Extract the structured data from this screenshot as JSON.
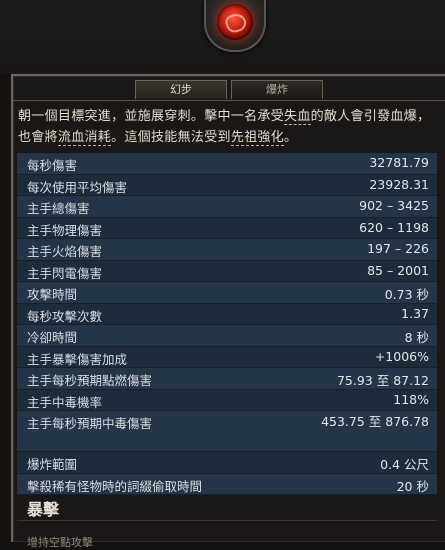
{
  "tabs": [
    "幻步",
    "爆炸"
  ],
  "description": {
    "pre_1": "朝一個目標突進，並施展穿刺。擊中一名承受",
    "kw_bleed": "失血",
    "pre_2": "的敵人會引發血爆，也會將",
    "kw_drain": "流血消耗",
    "pre_3": "。這個技能無法受到",
    "kw_ancestral": "先祖強化",
    "post": "。"
  },
  "stats": [
    {
      "label": "每秒傷害",
      "value": "32781.79"
    },
    {
      "label": "每次使用平均傷害",
      "value": "23928.31"
    },
    {
      "label": "主手總傷害",
      "value": "902 – 3425"
    },
    {
      "label": "主手物理傷害",
      "value": "620 – 1198"
    },
    {
      "label": "主手火焰傷害",
      "value": "197 – 226"
    },
    {
      "label": "主手閃電傷害",
      "value": "85 – 2001"
    },
    {
      "label": "攻擊時間",
      "value": "0.73 秒"
    },
    {
      "label": "每秒攻擊次數",
      "value": "1.37"
    },
    {
      "label": "冷卻時間",
      "value": "8 秒"
    },
    {
      "label": "主手暴擊傷害加成",
      "value": "+1006%"
    },
    {
      "label": "主手每秒預期點燃傷害",
      "value": "75.93 至 87.12"
    },
    {
      "label": "主手中毒機率",
      "value": "118%"
    },
    {
      "label": "主手每秒預期中毒傷害",
      "value": "453.75 至 876.78"
    },
    {
      "label": "爆炸範圍",
      "value": "0.4 公尺"
    },
    {
      "label": "擊殺稀有怪物時的詞綴偷取時間",
      "value": "20 秒"
    }
  ],
  "section_title": "暴擊",
  "cut_off_text": "增持空點攻擊"
}
